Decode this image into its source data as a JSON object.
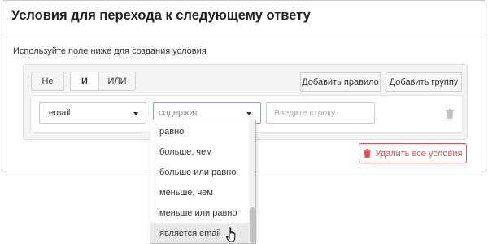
{
  "dialog": {
    "title": "Условия для перехода к следующему ответу",
    "hint": "Используйте поле ниже для создания условия"
  },
  "builder": {
    "logic": {
      "not_label": "Не",
      "and_label": "И",
      "or_label": "ИЛИ",
      "active": "И"
    },
    "add_rule_label": "Добавить правило",
    "add_group_label": "Добавить группу",
    "rule": {
      "field_value": "email",
      "operator_placeholder": "содержит",
      "value_placeholder": "Введите строку",
      "delete_icon": "trash-icon"
    }
  },
  "delete_all_label": "Удалить все условия",
  "delete_all_icon": "trash-icon",
  "operator_dropdown": {
    "items": [
      "равно",
      "больше, чем",
      "больше или равно",
      "меньше, чем",
      "меньше или равно",
      "является email"
    ],
    "hovered": "является email"
  },
  "colors": {
    "danger": "#d9534f",
    "focus_border": "#8aa3c8",
    "hover_bg": "#e9e9e9"
  }
}
